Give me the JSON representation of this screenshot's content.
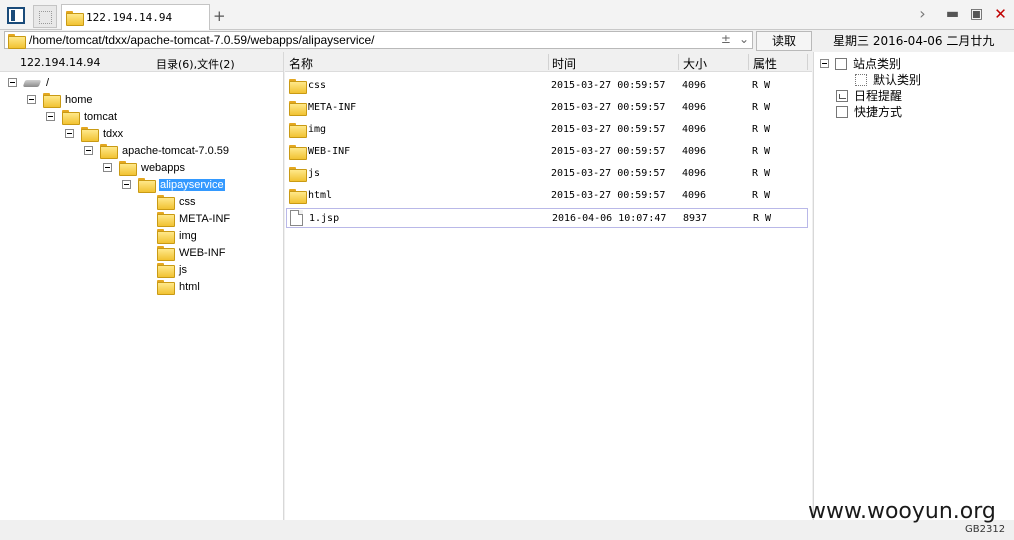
{
  "tabbar": {
    "active_tab_label": "122.194.14.94",
    "add_tab_glyph": "+",
    "icons": [
      "app-panel-icon",
      "blank-tab-icon",
      "folder-icon",
      "chevron-right-icon",
      "minimize-icon",
      "maximize-icon",
      "close-icon"
    ]
  },
  "address": {
    "path": "/home/tomcat/tdxx/apache-tomcat-7.0.59/webapps/alipayservice/",
    "read_button": "读取"
  },
  "date_info": "星期三  2016-04-06  二月廿九",
  "tree": {
    "host": "122.194.14.94",
    "summary": "目录(6),文件(2)",
    "nodes": [
      {
        "label": "/"
      },
      {
        "label": "home"
      },
      {
        "label": "tomcat"
      },
      {
        "label": "tdxx"
      },
      {
        "label": "apache-tomcat-7.0.59"
      },
      {
        "label": "webapps"
      },
      {
        "label": "alipayservice"
      },
      {
        "label": "css"
      },
      {
        "label": "META-INF"
      },
      {
        "label": "img"
      },
      {
        "label": "WEB-INF"
      },
      {
        "label": "js"
      },
      {
        "label": "html"
      }
    ]
  },
  "list": {
    "columns": {
      "name": "名称",
      "time": "时间",
      "size": "大小",
      "attr": "属性"
    },
    "rows": [
      {
        "name": "css",
        "time": "2015-03-27 00:59:57",
        "size": "4096",
        "attr": "R W",
        "type": "folder"
      },
      {
        "name": "META-INF",
        "time": "2015-03-27 00:59:57",
        "size": "4096",
        "attr": "R W",
        "type": "folder"
      },
      {
        "name": "img",
        "time": "2015-03-27 00:59:57",
        "size": "4096",
        "attr": "R W",
        "type": "folder"
      },
      {
        "name": "WEB-INF",
        "time": "2015-03-27 00:59:57",
        "size": "4096",
        "attr": "R W",
        "type": "folder"
      },
      {
        "name": "js",
        "time": "2015-03-27 00:59:57",
        "size": "4096",
        "attr": "R W",
        "type": "folder"
      },
      {
        "name": "html",
        "time": "2015-03-27 00:59:57",
        "size": "4096",
        "attr": "R W",
        "type": "folder"
      },
      {
        "name": "1.jsp",
        "time": "2016-04-06 10:07:47",
        "size": "8937",
        "attr": "R W",
        "type": "file"
      }
    ]
  },
  "sidebar": {
    "site_category": "站点类别",
    "default_category": "默认类别",
    "schedule": "日程提醒",
    "shortcuts": "快捷方式"
  },
  "watermark": "www.wooyun.org",
  "encoding": "GB2312",
  "colors": {
    "selection": "#3399ff",
    "close": "#c00000",
    "folder": "#f1c232"
  }
}
